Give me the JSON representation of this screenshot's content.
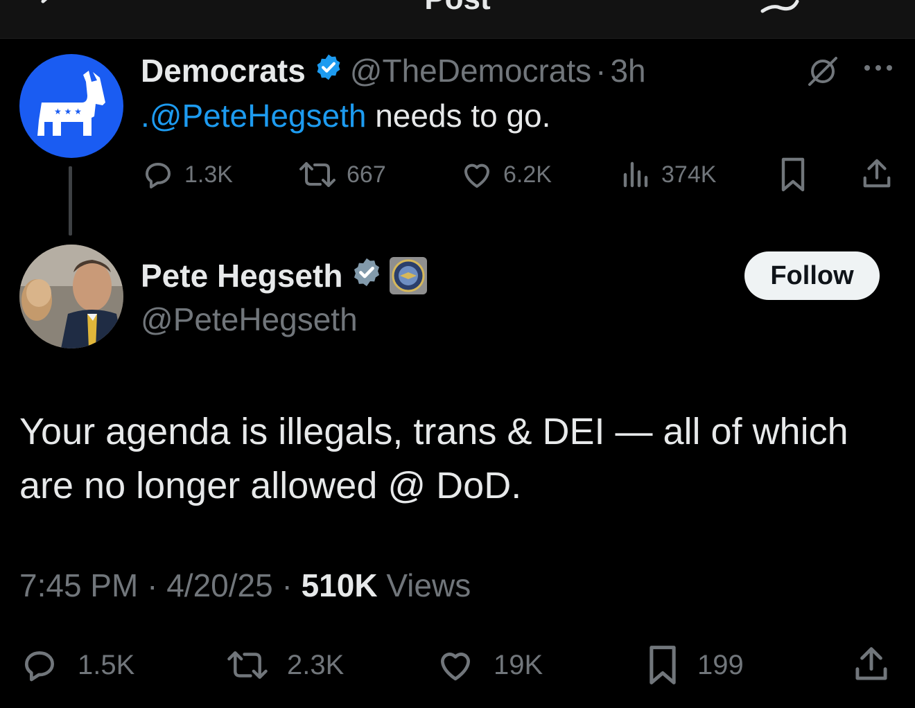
{
  "topbar": {
    "title": "Post"
  },
  "parent_post": {
    "author_name": "Democrats",
    "handle": "@TheDemocrats",
    "separator": "·",
    "time": "3h",
    "text_mention": ".@PeteHegseth",
    "text_rest": " needs to go.",
    "replies": "1.3K",
    "reposts": "667",
    "likes": "6.2K",
    "views": "374K"
  },
  "main_post": {
    "author_name": "Pete Hegseth",
    "handle": "@PeteHegseth",
    "follow_label": "Follow",
    "text": "Your agenda is illegals, trans & DEI — all of which are no longer allowed @ DoD.",
    "time": "7:45 PM",
    "sep1": " · ",
    "date": "4/20/25",
    "sep2": " · ",
    "views_count": "510K",
    "views_label": " Views",
    "replies": "1.5K",
    "reposts": "2.3K",
    "likes": "19K",
    "bookmarks": "199"
  },
  "colors": {
    "background": "#000000",
    "accent": "#1d9bf0",
    "muted": "#71767b",
    "text": "#e7e9ea",
    "democrats_avatar": "#1a5cf2"
  },
  "icons": [
    "back-arrow-icon",
    "reply-icon",
    "verified-badge-icon",
    "grok-icon",
    "more-icon",
    "repost-icon",
    "like-icon",
    "views-icon",
    "bookmark-icon",
    "share-icon",
    "dod-seal-icon"
  ]
}
